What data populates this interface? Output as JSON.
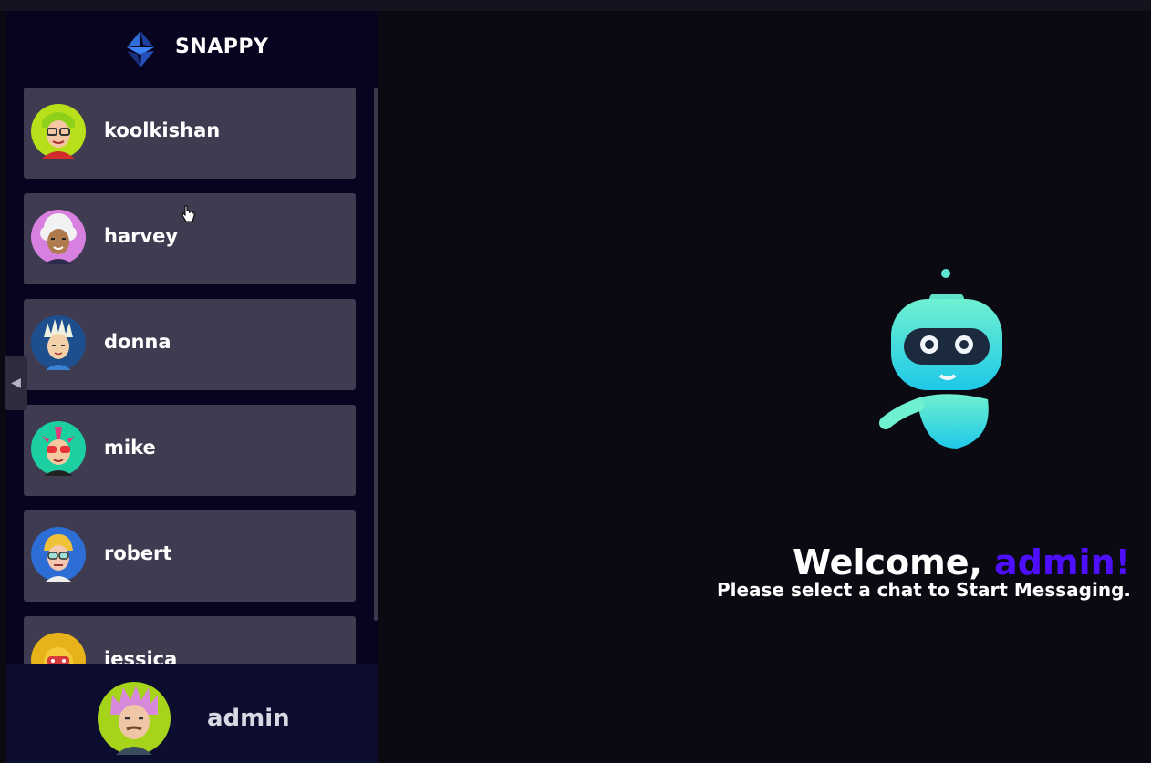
{
  "brand": {
    "name": "SNAPPY"
  },
  "contacts": [
    {
      "name": "koolkishan",
      "avatar": "avatar-green-glasses"
    },
    {
      "name": "harvey",
      "avatar": "avatar-white-hair-pink"
    },
    {
      "name": "donna",
      "avatar": "avatar-spiky-blue"
    },
    {
      "name": "mike",
      "avatar": "avatar-mohawk-teal"
    },
    {
      "name": "robert",
      "avatar": "avatar-blonde-glasses"
    },
    {
      "name": "jessica",
      "avatar": "avatar-yellow-mask"
    }
  ],
  "current_user": {
    "name": "admin",
    "avatar": "avatar-pink-hair-lime"
  },
  "welcome": {
    "greeting": "Welcome, ",
    "username": "admin!",
    "subtitle": "Please select a chat to Start Messaging."
  },
  "colors": {
    "accent": "#4e0eff",
    "sidebar_bg": "#080420",
    "contact_bg": "#3f3b51",
    "main_bg": "#0b0a13"
  }
}
